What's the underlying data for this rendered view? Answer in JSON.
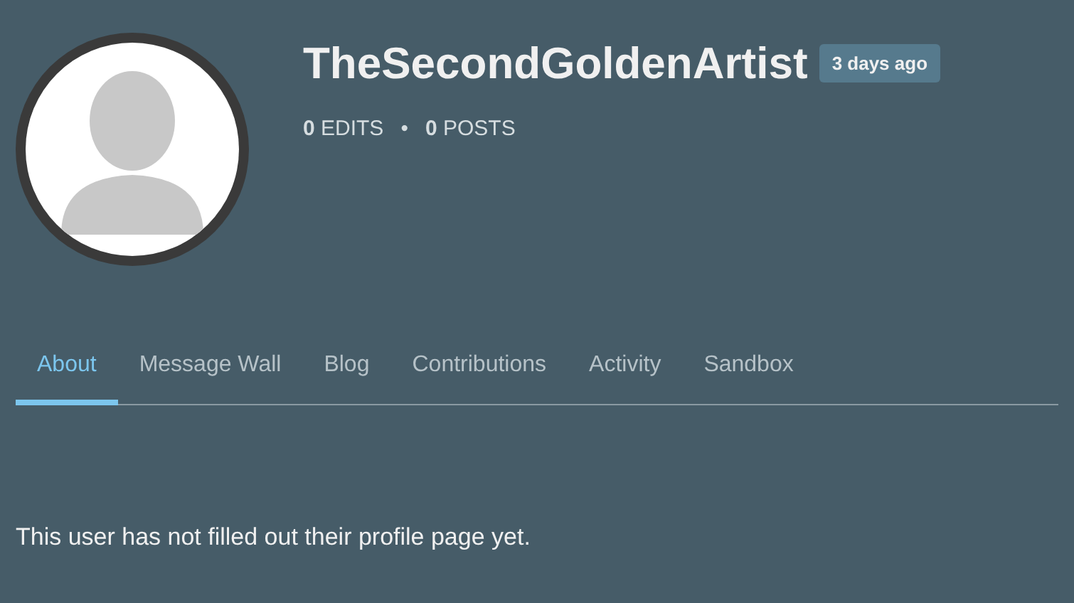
{
  "profile": {
    "username": "TheSecondGoldenArtist",
    "joined": "3 days ago",
    "stats": [
      {
        "count": "0",
        "label": "EDITS"
      },
      {
        "count": "0",
        "label": "POSTS"
      }
    ],
    "separator": "•"
  },
  "tabs": [
    {
      "label": "About",
      "selected": true
    },
    {
      "label": "Message Wall",
      "selected": false
    },
    {
      "label": "Blog",
      "selected": false
    },
    {
      "label": "Contributions",
      "selected": false
    },
    {
      "label": "Activity",
      "selected": false
    },
    {
      "label": "Sandbox",
      "selected": false
    }
  ],
  "content": {
    "text": "This user has not filled out their profile page yet."
  }
}
